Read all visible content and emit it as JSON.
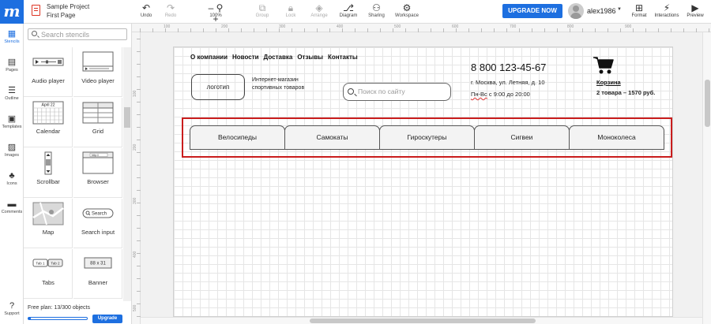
{
  "app": {
    "logo_letter": "m",
    "project_name": "Sample Project",
    "page_name": "First Page"
  },
  "toolbar": {
    "undo": "Undo",
    "redo": "Redo",
    "zoom": "100%",
    "group": "Group",
    "lock": "Lock",
    "arrange": "Arrange",
    "diagram": "Diagram",
    "sharing": "Sharing",
    "workspace": "Workspace",
    "upgrade_now": "UPGRADE NOW",
    "username": "alex1986",
    "format": "Format",
    "interactions": "Interactions",
    "preview": "Preview"
  },
  "rail": [
    "Stencils",
    "Pages",
    "Outline",
    "Templates",
    "Images",
    "Icons",
    "Comments",
    "Support"
  ],
  "stencil_panel": {
    "search_placeholder": "Search stencils",
    "items": [
      "Audio player",
      "Video player",
      "Calendar",
      "Grid",
      "Scrollbar",
      "Browser",
      "Map",
      "Search input",
      "Tabs",
      "Banner"
    ],
    "calendar_thumb": "April 22",
    "browser_thumb": "http://",
    "search_thumb": "Search",
    "tabs_thumb": [
      "Tab 1",
      "Tab 2"
    ],
    "banner_thumb": "88 x 31",
    "plan_text": "Free plan: 13/300 objects",
    "plan_used": 13,
    "plan_limit": 300,
    "plan_upgrade": "Upgrade"
  },
  "rulers": {
    "top": [
      "100",
      "200",
      "300",
      "400",
      "500",
      "600",
      "700",
      "800",
      "900"
    ],
    "left": [
      "100",
      "200",
      "300",
      "400",
      "500"
    ]
  },
  "wireframe": {
    "nav": [
      "О компании",
      "Новости",
      "Доставка",
      "Отзывы",
      "Контакты"
    ],
    "logo": "логотип",
    "tagline": "Интернет-магазин спортивных товаров",
    "search_placeholder": "Поиск по сайту",
    "phone": "8 800 123-45-67",
    "address": "г. Москва, ул. Летняя, д. 10",
    "hours_prefix": "Пн-Вс",
    "hours_rest": " с 9:00 до 20:00",
    "cart_label": "Корзина",
    "cart_info": "2 товара – 1570 руб.",
    "menu_tabs": [
      "Велосипеды",
      "Самокаты",
      "Гироскутеры",
      "Сигвеи",
      "Моноколеса"
    ]
  },
  "colors": {
    "accent": "#1d6fe0",
    "selection": "#c91d1d"
  }
}
